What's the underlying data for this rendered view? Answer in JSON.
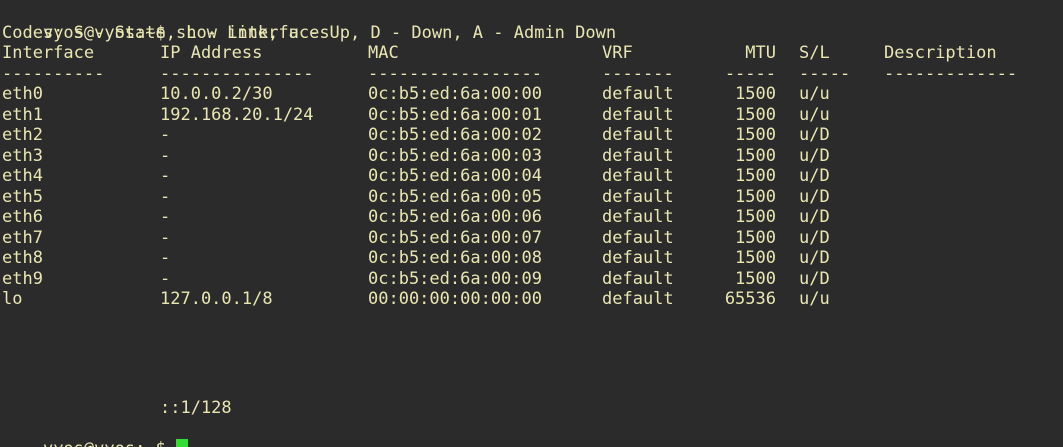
{
  "terminal": {
    "prompt": "vyos@vyos:~$",
    "command": "show interfaces",
    "codes": "Codes: S - State, L - Link, u - Up, D - Down, A - Admin Down",
    "headers": [
      "Interface",
      "IP Address",
      "MAC",
      "VRF",
      "MTU",
      "S/L",
      "Description"
    ],
    "separators": [
      "----------",
      "---------------",
      "-----------------",
      "-------",
      "-----",
      "-----",
      "-------------"
    ],
    "rows": [
      [
        "eth0",
        "10.0.0.2/30",
        "0c:b5:ed:6a:00:00",
        "default",
        "1500",
        "u/u",
        ""
      ],
      [
        "eth1",
        "192.168.20.1/24",
        "0c:b5:ed:6a:00:01",
        "default",
        "1500",
        "u/u",
        ""
      ],
      [
        "eth2",
        "-",
        "0c:b5:ed:6a:00:02",
        "default",
        "1500",
        "u/D",
        ""
      ],
      [
        "eth3",
        "-",
        "0c:b5:ed:6a:00:03",
        "default",
        "1500",
        "u/D",
        ""
      ],
      [
        "eth4",
        "-",
        "0c:b5:ed:6a:00:04",
        "default",
        "1500",
        "u/D",
        ""
      ],
      [
        "eth5",
        "-",
        "0c:b5:ed:6a:00:05",
        "default",
        "1500",
        "u/D",
        ""
      ],
      [
        "eth6",
        "-",
        "0c:b5:ed:6a:00:06",
        "default",
        "1500",
        "u/D",
        ""
      ],
      [
        "eth7",
        "-",
        "0c:b5:ed:6a:00:07",
        "default",
        "1500",
        "u/D",
        ""
      ],
      [
        "eth8",
        "-",
        "0c:b5:ed:6a:00:08",
        "default",
        "1500",
        "u/D",
        ""
      ],
      [
        "eth9",
        "-",
        "0c:b5:ed:6a:00:09",
        "default",
        "1500",
        "u/D",
        ""
      ],
      [
        "lo",
        "127.0.0.1/8",
        "00:00:00:00:00:00",
        "default",
        "65536",
        "u/u",
        ""
      ]
    ],
    "extra_address": "::1/128",
    "final_prompt": "vyos@vyos:~$",
    "colors": {
      "background": "#2b2b2b",
      "foreground": "#e9e6b2",
      "cursor": "#33dd33"
    }
  }
}
